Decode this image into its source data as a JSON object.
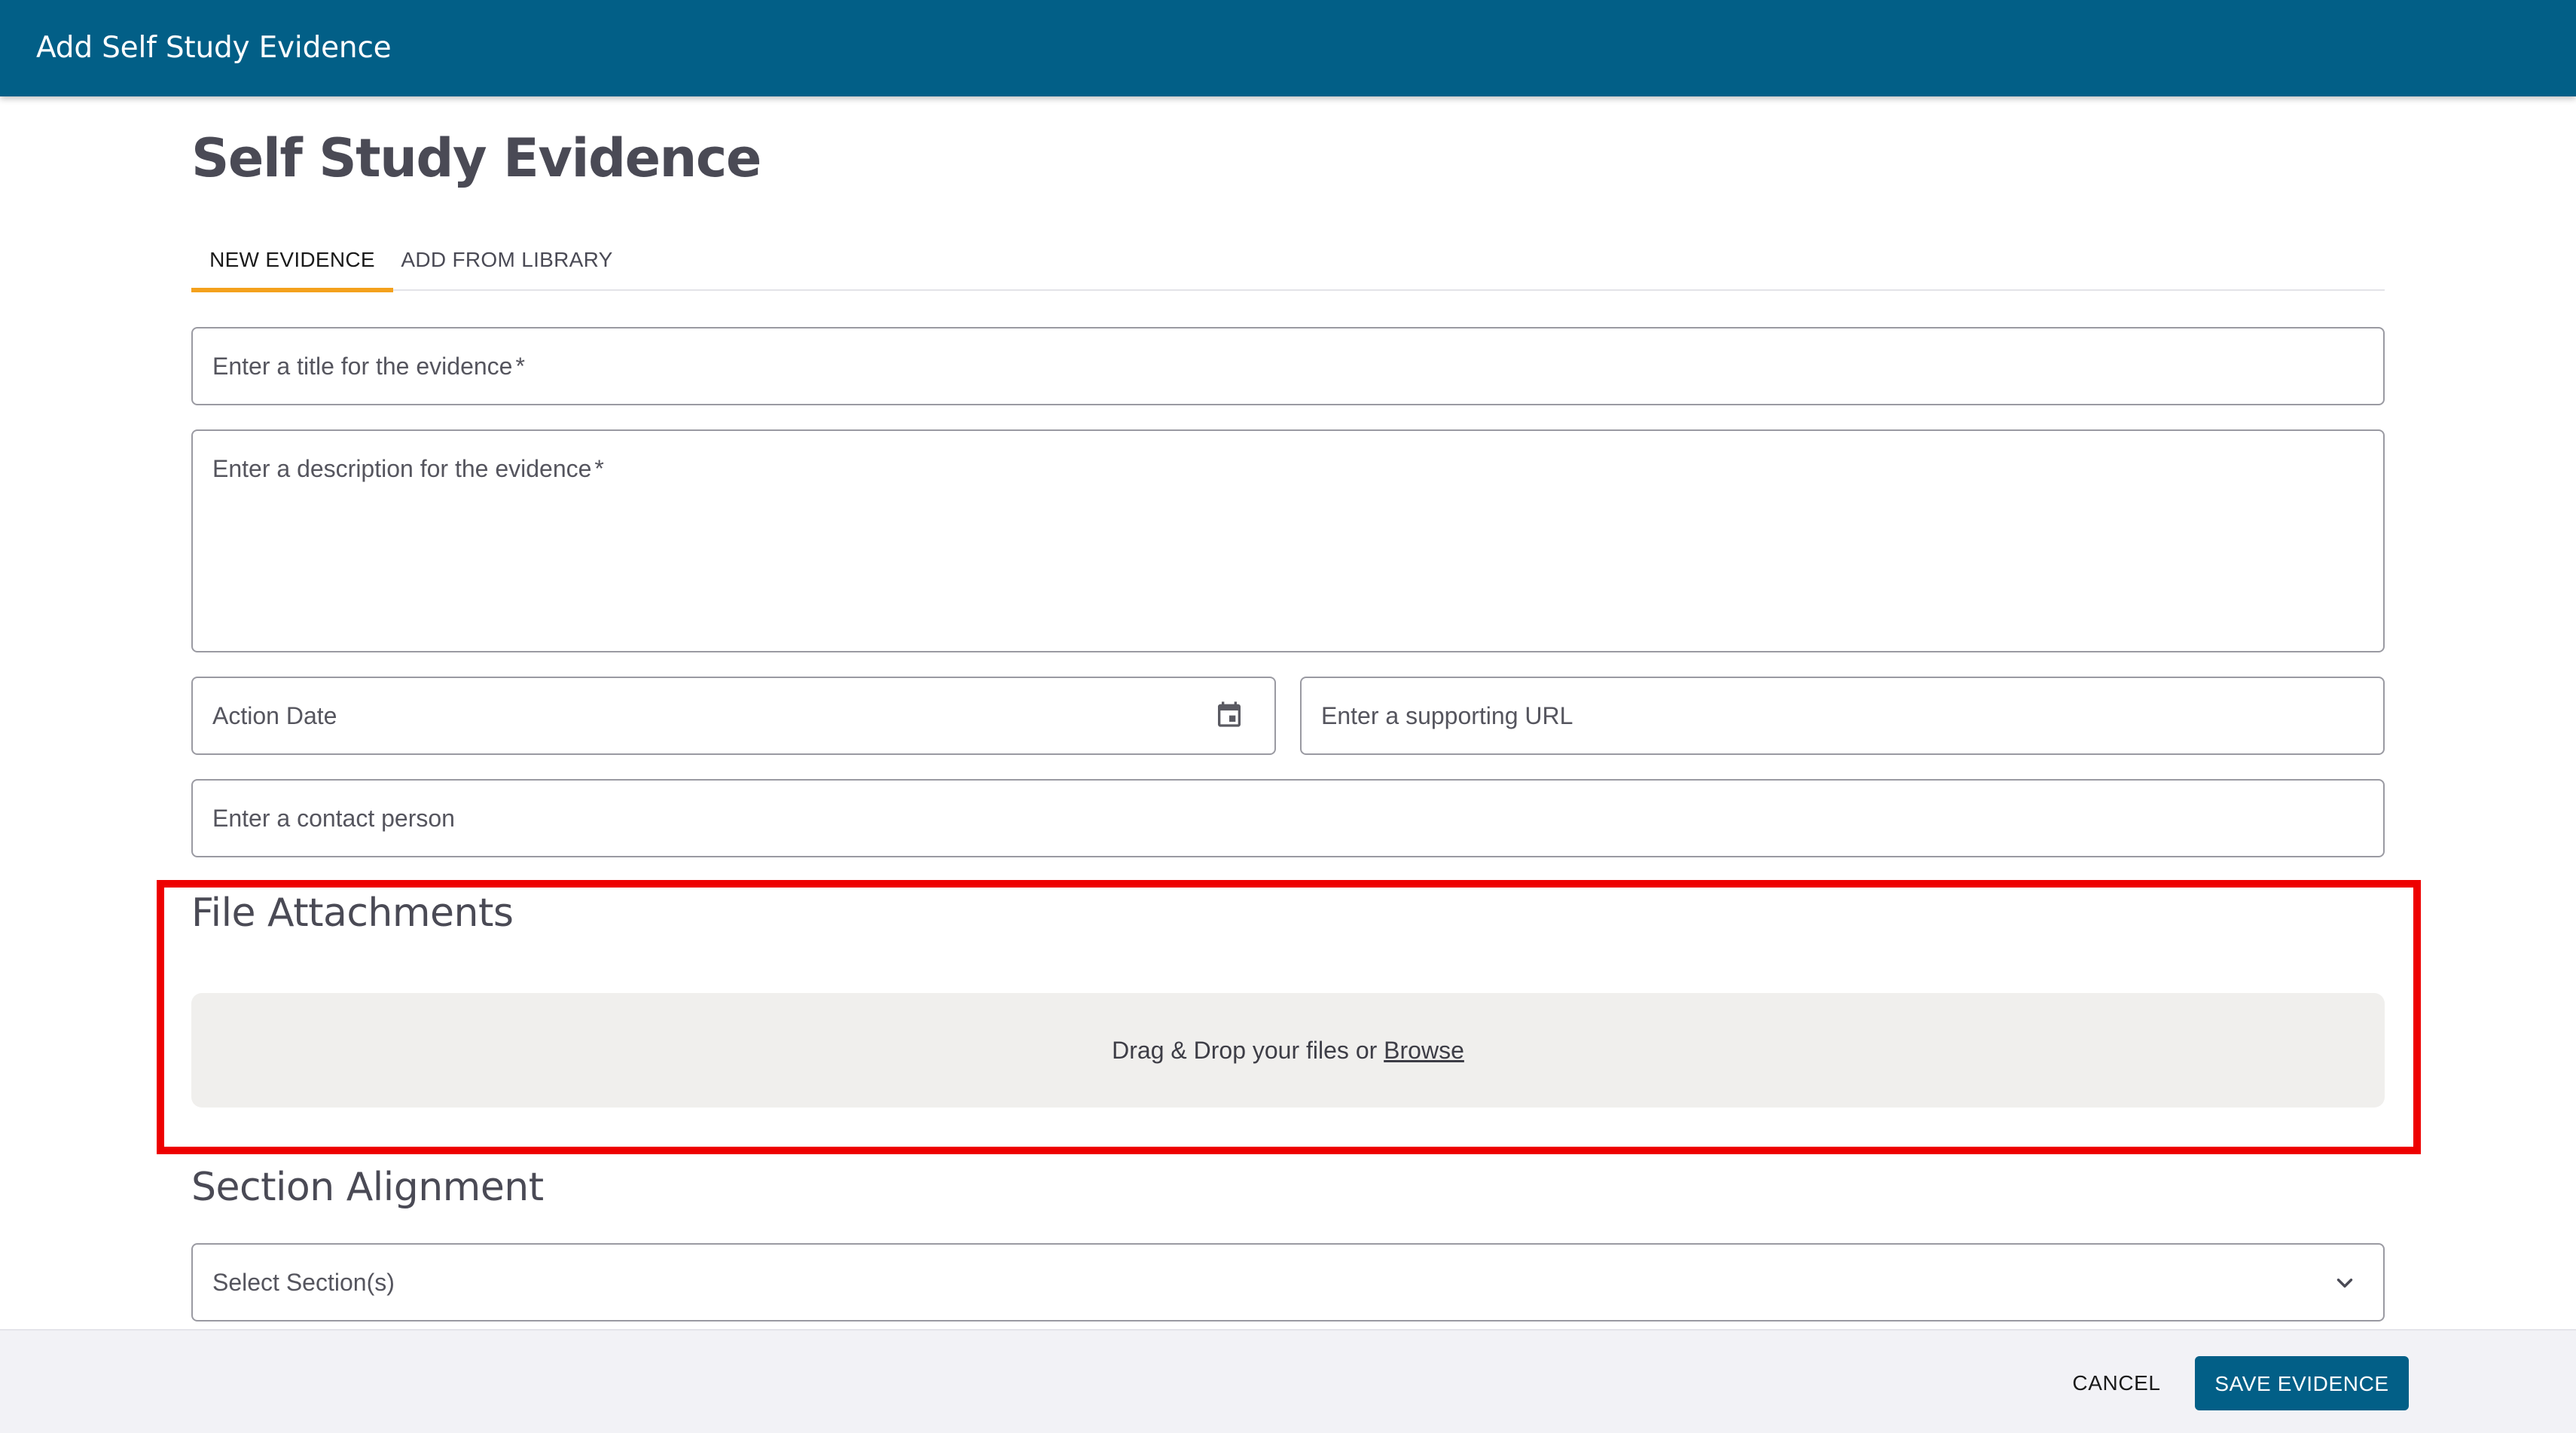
{
  "topbar": {
    "title": "Add Self Study Evidence"
  },
  "page": {
    "title": "Self Study Evidence"
  },
  "tabs": [
    {
      "label": "NEW EVIDENCE",
      "active": true
    },
    {
      "label": "ADD FROM LIBRARY",
      "active": false
    }
  ],
  "form": {
    "title_placeholder": "Enter a title for the evidence",
    "description_placeholder": "Enter a description for the evidence",
    "required_marker": "*",
    "action_date_label": "Action Date",
    "url_placeholder": "Enter a supporting URL",
    "contact_placeholder": "Enter a contact person"
  },
  "attachments": {
    "heading": "File Attachments",
    "dropzone_text": "Drag & Drop your files or ",
    "browse_label": "Browse"
  },
  "alignment": {
    "heading": "Section Alignment",
    "select_placeholder": "Select Section(s)"
  },
  "footer": {
    "cancel_label": "CANCEL",
    "save_label": "SAVE EVIDENCE"
  },
  "colors": {
    "brand": "#025f87",
    "tab_indicator": "#f4a11c",
    "highlight": "#ee0000"
  },
  "icons": {
    "date_field": "calendar-icon",
    "select_field": "chevron-down-icon"
  }
}
